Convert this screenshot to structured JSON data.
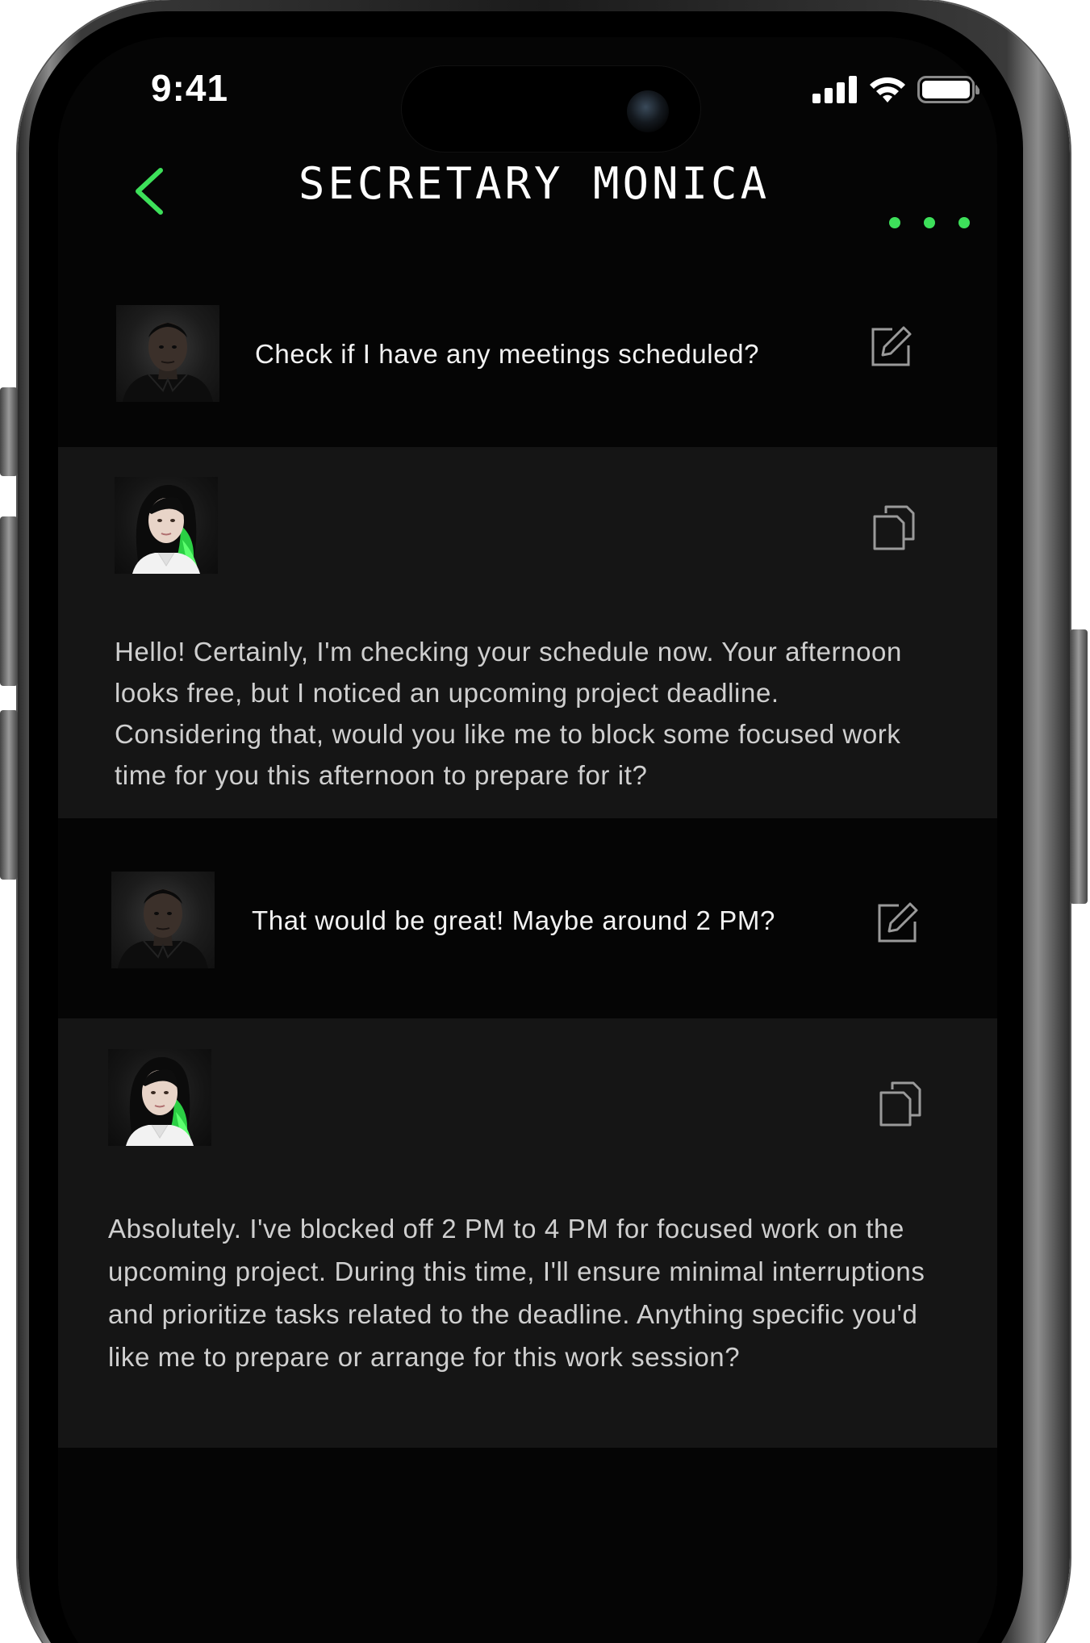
{
  "status_bar": {
    "time": "9:41",
    "icons": [
      "cellular-signal-icon",
      "wifi-icon",
      "battery-icon"
    ]
  },
  "header": {
    "title": "SECRETARY MONICA",
    "back_icon": "chevron-left-icon",
    "more_icon": "more-dots-icon",
    "accent_color": "#3de05a"
  },
  "messages": [
    {
      "role": "user",
      "text": "Check if I have any meetings scheduled?",
      "action_icon": "edit-icon"
    },
    {
      "role": "assistant",
      "text": "Hello! Certainly, I'm checking your schedule now. Your afternoon looks free, but I noticed an upcoming project deadline. Considering that, would you like me to block some focused work time for you this afternoon to prepare for it?",
      "action_icon": "copy-icon"
    },
    {
      "role": "user",
      "text": "That would be great! Maybe around 2 PM?",
      "action_icon": "edit-icon"
    },
    {
      "role": "assistant",
      "text": "Absolutely. I've blocked off 2 PM to 4 PM for focused work on the upcoming project. During this time, I'll ensure minimal interruptions and prioritize tasks related to the deadline. Anything specific you'd like me to prepare or arrange for this work session?",
      "action_icon": "copy-icon"
    }
  ]
}
